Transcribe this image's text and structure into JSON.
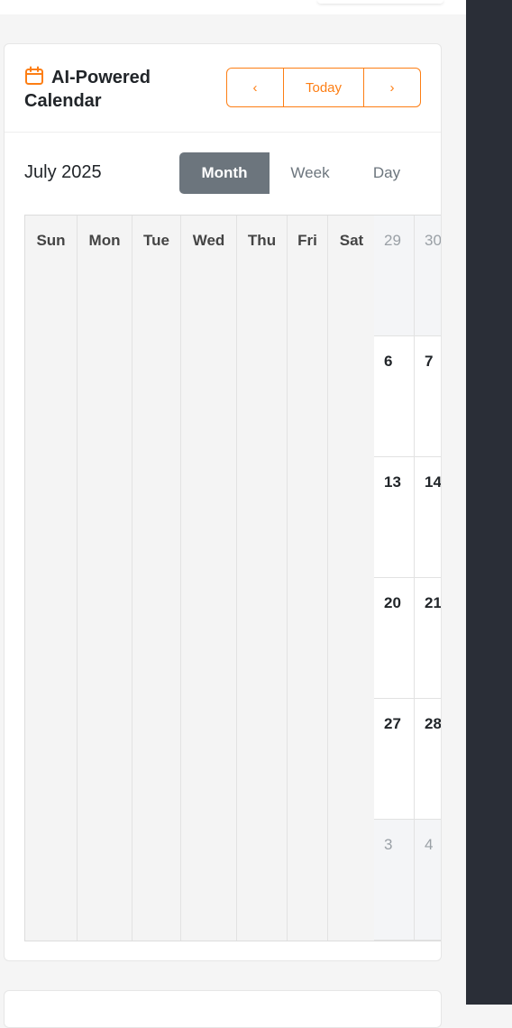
{
  "calendar": {
    "title": "AI-Powered Calendar",
    "nav": {
      "prev": "‹",
      "today": "Today",
      "next": "›"
    },
    "month_label": "July 2025",
    "views": {
      "month": "Month",
      "week": "Week",
      "day": "Day"
    },
    "weekdays": [
      "Sun",
      "Mon",
      "Tue",
      "Wed",
      "Thu",
      "Fri",
      "Sat"
    ],
    "weeks": [
      [
        "29",
        "30"
      ],
      [
        "6",
        "7"
      ],
      [
        "13",
        "14"
      ],
      [
        "20",
        "21"
      ],
      [
        "27",
        "28"
      ],
      [
        "3",
        "4"
      ]
    ]
  },
  "colors": {
    "accent": "#fd7e14",
    "active_tab": "#6c757d",
    "sidebar": "#2a2e37"
  },
  "icons": {
    "title": "calendar-icon"
  }
}
